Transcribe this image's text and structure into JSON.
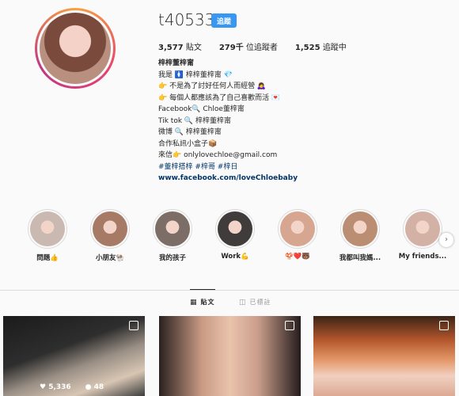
{
  "profile": {
    "username": "t40533",
    "follow_label": "追蹤",
    "stats": [
      {
        "value": "3,577",
        "label": "貼文"
      },
      {
        "value": "279千",
        "label": "位追蹤者"
      },
      {
        "value": "1,525",
        "label": "追蹤中"
      }
    ],
    "bio": {
      "name": "梓梓董梓甯",
      "lines": [
        "我是 🚺 梓梓董梓甯 💎",
        "👉 不是為了討好任何人而經營 🙇‍♀️",
        "👉 每個人都應該為了自己喜歡而活 💌",
        "Facebook🔍 Chloe董梓甯",
        "Tik tok 🔍 梓梓董梓甯",
        "微博 🔍 梓梓董梓甯",
        "合作私訊小盒子📦",
        "來信👉 onlylovechloe@gmail.com"
      ],
      "tags": "#董梓搭梓 #梓哥 #梓日",
      "link": "www.facebook.com/loveChloebaby"
    }
  },
  "highlights": [
    {
      "label": "問題👍",
      "color": "#c9b9b0"
    },
    {
      "label": "小朋友🐏",
      "color": "#a77a66"
    },
    {
      "label": "我的孩子",
      "color": "#7c6d66"
    },
    {
      "label": "Work💪",
      "color": "#3f3c3b"
    },
    {
      "label": "🍄❤️🐻",
      "color": "#d6a690"
    },
    {
      "label": "我都叫我媽...",
      "color": "#bb8d72"
    },
    {
      "label": "My friends...",
      "color": "#d3b1a5"
    }
  ],
  "tabs": [
    {
      "icon": "▦",
      "label": "貼文",
      "active": true
    },
    {
      "icon": "◫",
      "label": "已標註",
      "active": false
    }
  ],
  "posts": [
    {
      "likes": "5,336",
      "comments": "48"
    },
    {
      "likes": "",
      "comments": ""
    },
    {
      "likes": "",
      "comments": ""
    }
  ]
}
